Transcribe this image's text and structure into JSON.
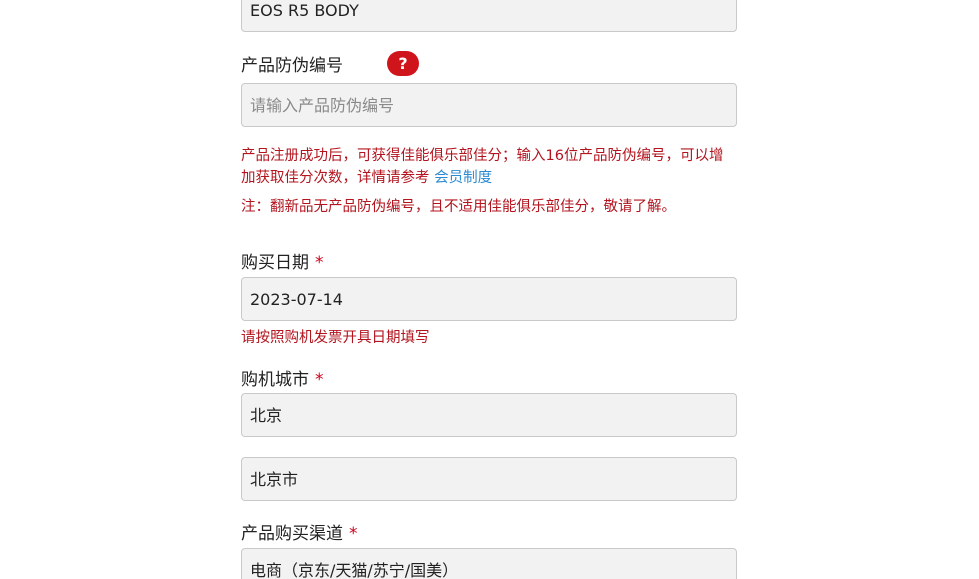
{
  "model_field": {
    "value": "EOS R5 BODY"
  },
  "serial": {
    "label": "产品防伪编号",
    "help_icon": "?",
    "placeholder": "请输入产品防伪编号",
    "note_text": "产品注册成功后，可获得佳能俱乐部佳分；输入16位产品防伪编号，可以增加获取佳分次数，详情请参考",
    "note_link": "会员制度",
    "note2": "注：翻新品无产品防伪编号，且不适用佳能俱乐部佳分，敬请了解。"
  },
  "purchase_date": {
    "label": "购买日期",
    "required_mark": "*",
    "value": "2023-07-14",
    "hint": "请按照购机发票开具日期填写"
  },
  "purchase_city": {
    "label": "购机城市",
    "required_mark": "*",
    "province": "北京",
    "city": "北京市"
  },
  "channel": {
    "label": "产品购买渠道",
    "required_mark": "*",
    "value": "电商（京东/天猫/苏宁/国美）"
  },
  "colors": {
    "accent_red": "#d0141c",
    "note_red": "#b3141e",
    "link_blue": "#2c8ad0"
  }
}
